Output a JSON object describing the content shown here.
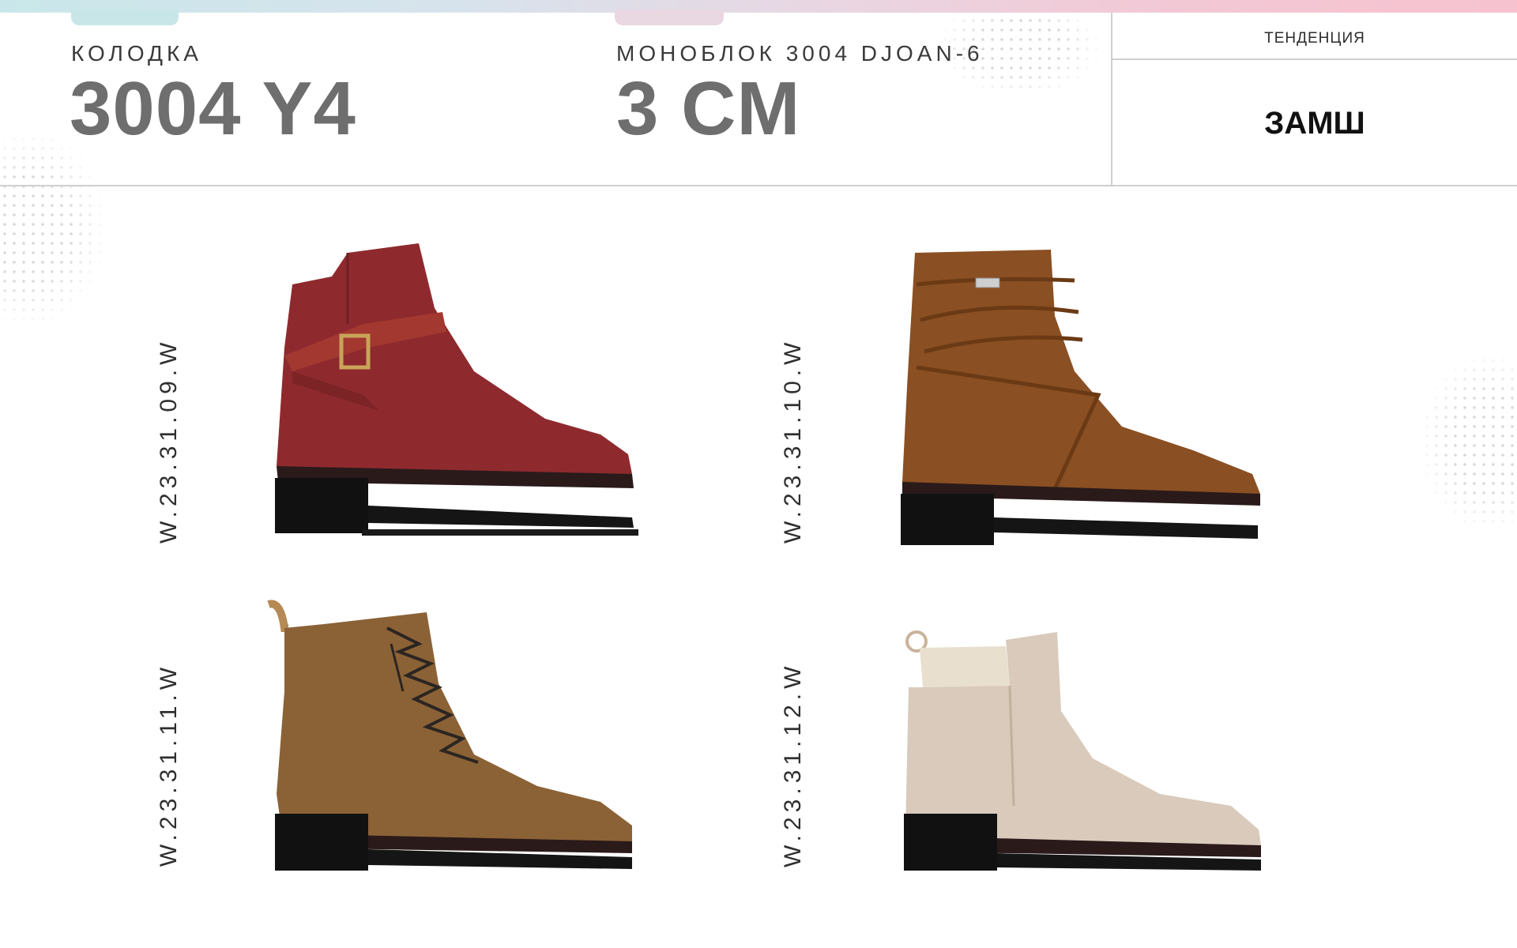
{
  "header": {
    "last_label": "КОЛОДКА",
    "last_value": "3004 Y4",
    "sole_label": "МОНОБЛОК 3004 DJOAN-6",
    "sole_value": "3 CM",
    "trend_label": "ТЕНДЕНЦИЯ",
    "trend_value": "ЗАМШ"
  },
  "products": [
    {
      "sku": "W.23.31.09.W",
      "color": "#8e2a2e",
      "style": "strap-buckle-boot"
    },
    {
      "sku": "W.23.31.10.W",
      "color": "#8a4f22",
      "style": "wrap-lace-boot"
    },
    {
      "sku": "W.23.31.11.W",
      "color": "#8b6236",
      "style": "lace-up-boot"
    },
    {
      "sku": "W.23.31.12.W",
      "color": "#d9cabb",
      "style": "chelsea-boot"
    }
  ]
}
